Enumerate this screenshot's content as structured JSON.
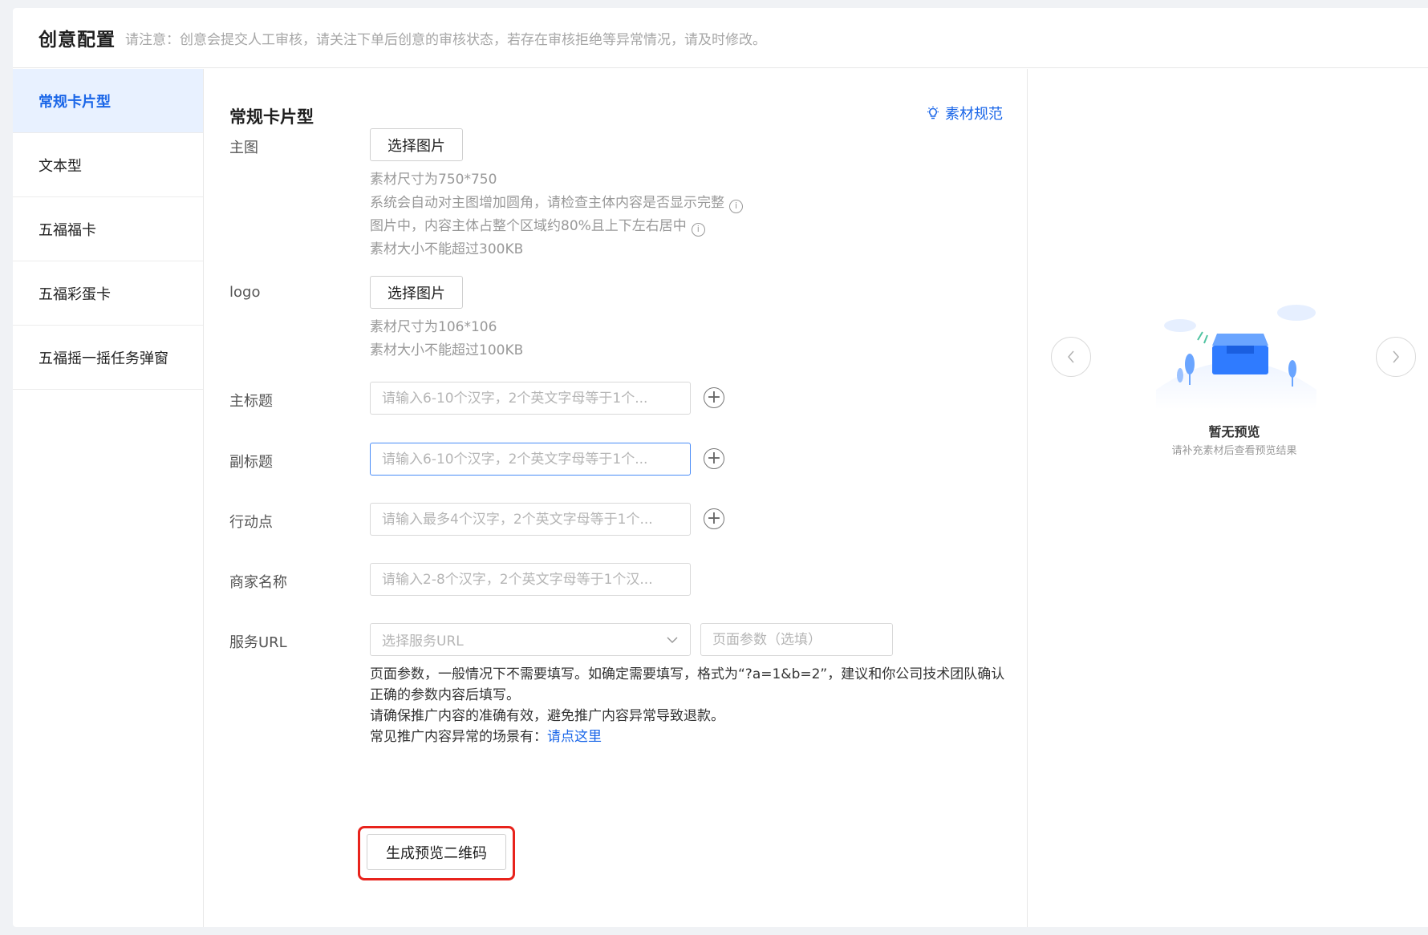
{
  "header": {
    "title": "创意配置",
    "note": "请注意：创意会提交人工审核，请关注下单后创意的审核状态，若存在审核拒绝等异常情况，请及时修改。"
  },
  "sidebar": {
    "items": [
      {
        "label": "常规卡片型",
        "active": true
      },
      {
        "label": "文本型"
      },
      {
        "label": "五福福卡"
      },
      {
        "label": "五福彩蛋卡"
      },
      {
        "label": "五福摇一摇任务弹窗"
      }
    ]
  },
  "form": {
    "title": "常规卡片型",
    "spec_link": "素材规范",
    "main_image": {
      "label": "主图",
      "button": "选择图片",
      "hints": [
        "素材尺寸为750*750",
        "系统会自动对主图增加圆角，请检查主体内容是否显示完整",
        "图片中，内容主体占整个区域约80%且上下左右居中",
        "素材大小不能超过300KB"
      ]
    },
    "logo": {
      "label": "logo",
      "button": "选择图片",
      "hints": [
        "素材尺寸为106*106",
        "素材大小不能超过100KB"
      ]
    },
    "main_title": {
      "label": "主标题",
      "placeholder": "请输入6-10个汉字，2个英文字母等于1个..."
    },
    "sub_title": {
      "label": "副标题",
      "placeholder": "请输入6-10个汉字，2个英文字母等于1个..."
    },
    "action": {
      "label": "行动点",
      "placeholder": "请输入最多4个汉字，2个英文字母等于1个..."
    },
    "merchant": {
      "label": "商家名称",
      "placeholder": "请输入2-8个汉字，2个英文字母等于1个汉..."
    },
    "service_url": {
      "label": "服务URL",
      "select_placeholder": "选择服务URL",
      "param_placeholder": "页面参数（选填）",
      "desc_line1": "页面参数，一般情况下不需要填写。如确定需要填写，格式为“?a=1&b=2”，建议和你公司技术团队确认正确的参数内容后填写。",
      "desc_line2": "请确保推广内容的准确有效，避免推广内容异常导致退款。",
      "desc_line3_prefix": "常见推广内容异常的场景有：",
      "desc_link": "请点这里"
    },
    "generate_button": "生成预览二维码"
  },
  "preview": {
    "empty_title": "暂无预览",
    "empty_subtitle": "请补充素材后查看预览结果"
  },
  "colors": {
    "accent": "#1a66e8",
    "highlight": "#e8231c",
    "active_bg": "#e8f1ff"
  }
}
